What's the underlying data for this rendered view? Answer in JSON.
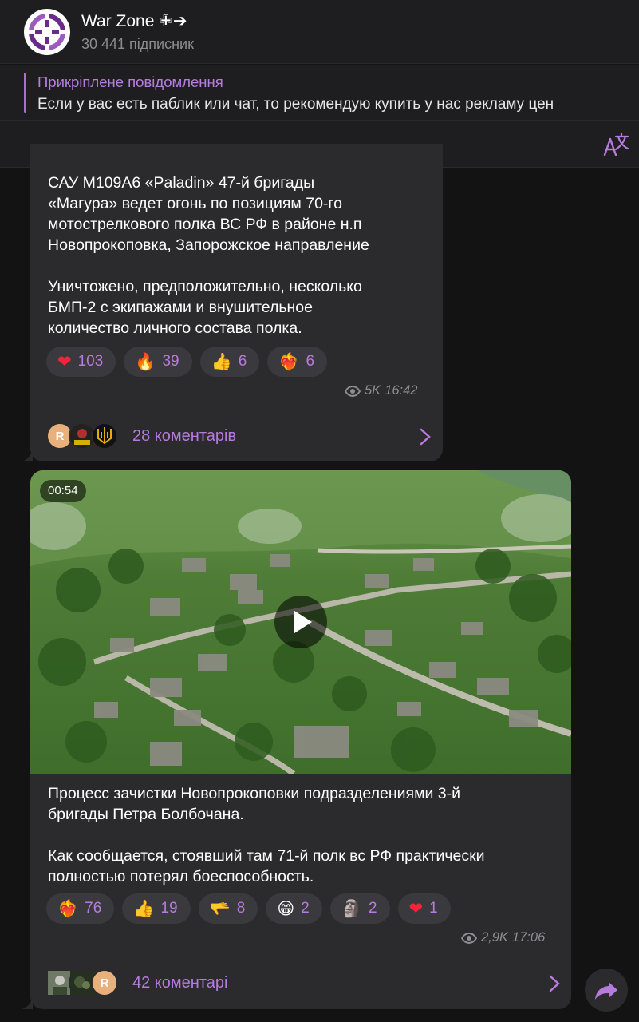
{
  "channel": {
    "title": "War Zone ✙➔",
    "subscribers": "30 441 підписник"
  },
  "pinned": {
    "title": "Прикріплене повідомлення",
    "text": "Если у вас есть паблик или чат, то рекомендую купить у нас рекламу цен"
  },
  "messages": [
    {
      "text": "САУ M109A6 «Paladin» 47-й бригады\n«Магура» ведет огонь по позициям 70-го\nмотострелкового полка ВС РФ в районе н.п\nНовопрокоповка, Запорожское направление\n\nУничтожено, предположительно, несколько\nБМП-2 с экипажами и внушительное\nколичество личного состава полка.",
      "reactions": [
        {
          "emoji": "❤",
          "icon": "heart-icon",
          "count": "103"
        },
        {
          "emoji": "🔥",
          "icon": "fire-icon",
          "count": "39"
        },
        {
          "emoji": "👍",
          "icon": "thumbs-up-icon",
          "count": "6"
        },
        {
          "emoji": "❤‍🔥",
          "icon": "heart-on-fire-icon",
          "count": "6"
        }
      ],
      "views": "5K",
      "time": "16:42",
      "comments": "28 коментарів",
      "comment_avatars": [
        "R",
        "",
        ""
      ]
    },
    {
      "video_duration": "00:54",
      "text": "Процесс зачистки Новопрокоповки подразделениями 3-й\nбригады Петра Болбочана.\n\nКак сообщается, стоявший там 71-й полк вс РФ практически\nполностью потерял боеспособность.",
      "reactions": [
        {
          "emoji": "❤‍🔥",
          "icon": "heart-on-fire-icon",
          "count": "76"
        },
        {
          "emoji": "👍",
          "icon": "thumbs-up-icon",
          "count": "19"
        },
        {
          "emoji": "🫳",
          "icon": "hand-icon",
          "count": "8"
        },
        {
          "emoji": "😁",
          "icon": "grin-icon",
          "count": "2"
        },
        {
          "emoji": "🗿",
          "icon": "moai-icon",
          "count": "2"
        },
        {
          "emoji": "❤",
          "icon": "heart-icon",
          "count": "1"
        }
      ],
      "views": "2,9K",
      "time": "17:06",
      "comments": "42 коментарі",
      "comment_avatars": [
        "",
        "",
        "R"
      ]
    }
  ],
  "colors": {
    "accent": "#b67bdc",
    "bubble": "#2b2b2e",
    "background": "#131314"
  }
}
